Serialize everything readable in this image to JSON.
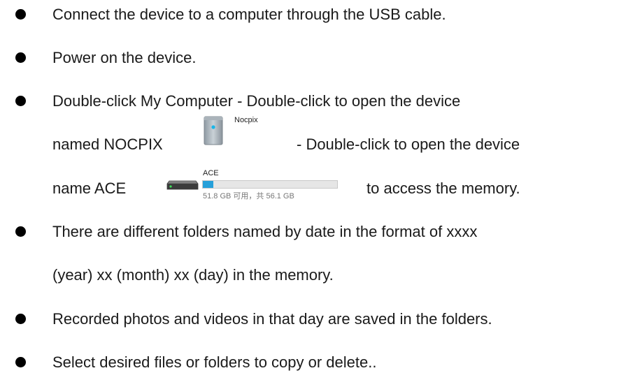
{
  "steps": [
    {
      "text": "Connect the device to a computer through the USB cable."
    },
    {
      "text": "Power on the device."
    },
    {
      "line1": "Double-click My Computer - Double-click to open the device",
      "line2_prefix": "named NOCPIX",
      "line2_suffix": "- Double-click to open the device",
      "line3_prefix": "name ACE",
      "line3_suffix": "to access the memory."
    },
    {
      "line1": "There are different folders named by date in the format of xxxx",
      "line2": "(year) xx (month) xx (day) in the memory."
    },
    {
      "text": "Recorded photos and videos in that day are saved in the folders."
    },
    {
      "text": "Select desired files or folders to copy or delete.."
    }
  ],
  "device": {
    "name": "Nocpix",
    "icon": "device-icon"
  },
  "drive": {
    "name": "ACE",
    "icon": "hard-drive-icon",
    "usage_fraction": 0.077,
    "info": "51.8 GB 可用，共 56.1 GB",
    "bar_color": "#26a0da"
  }
}
